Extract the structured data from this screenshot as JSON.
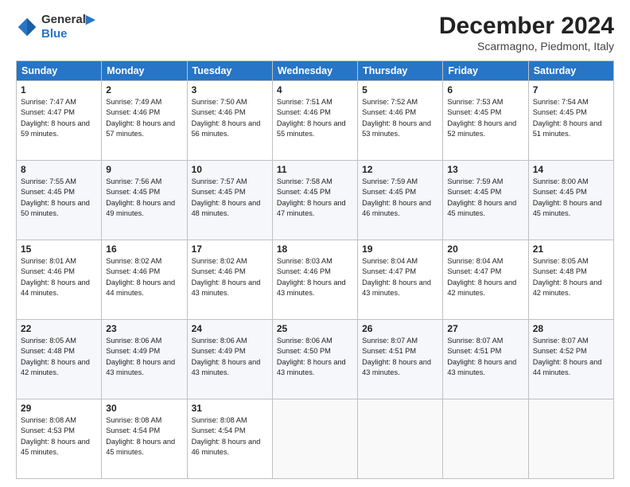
{
  "header": {
    "logo_line1": "General",
    "logo_line2": "Blue",
    "month_title": "December 2024",
    "location": "Scarmagno, Piedmont, Italy"
  },
  "weekdays": [
    "Sunday",
    "Monday",
    "Tuesday",
    "Wednesday",
    "Thursday",
    "Friday",
    "Saturday"
  ],
  "weeks": [
    [
      {
        "day": "1",
        "sunrise": "Sunrise: 7:47 AM",
        "sunset": "Sunset: 4:47 PM",
        "daylight": "Daylight: 8 hours and 59 minutes."
      },
      {
        "day": "2",
        "sunrise": "Sunrise: 7:49 AM",
        "sunset": "Sunset: 4:46 PM",
        "daylight": "Daylight: 8 hours and 57 minutes."
      },
      {
        "day": "3",
        "sunrise": "Sunrise: 7:50 AM",
        "sunset": "Sunset: 4:46 PM",
        "daylight": "Daylight: 8 hours and 56 minutes."
      },
      {
        "day": "4",
        "sunrise": "Sunrise: 7:51 AM",
        "sunset": "Sunset: 4:46 PM",
        "daylight": "Daylight: 8 hours and 55 minutes."
      },
      {
        "day": "5",
        "sunrise": "Sunrise: 7:52 AM",
        "sunset": "Sunset: 4:46 PM",
        "daylight": "Daylight: 8 hours and 53 minutes."
      },
      {
        "day": "6",
        "sunrise": "Sunrise: 7:53 AM",
        "sunset": "Sunset: 4:45 PM",
        "daylight": "Daylight: 8 hours and 52 minutes."
      },
      {
        "day": "7",
        "sunrise": "Sunrise: 7:54 AM",
        "sunset": "Sunset: 4:45 PM",
        "daylight": "Daylight: 8 hours and 51 minutes."
      }
    ],
    [
      {
        "day": "8",
        "sunrise": "Sunrise: 7:55 AM",
        "sunset": "Sunset: 4:45 PM",
        "daylight": "Daylight: 8 hours and 50 minutes."
      },
      {
        "day": "9",
        "sunrise": "Sunrise: 7:56 AM",
        "sunset": "Sunset: 4:45 PM",
        "daylight": "Daylight: 8 hours and 49 minutes."
      },
      {
        "day": "10",
        "sunrise": "Sunrise: 7:57 AM",
        "sunset": "Sunset: 4:45 PM",
        "daylight": "Daylight: 8 hours and 48 minutes."
      },
      {
        "day": "11",
        "sunrise": "Sunrise: 7:58 AM",
        "sunset": "Sunset: 4:45 PM",
        "daylight": "Daylight: 8 hours and 47 minutes."
      },
      {
        "day": "12",
        "sunrise": "Sunrise: 7:59 AM",
        "sunset": "Sunset: 4:45 PM",
        "daylight": "Daylight: 8 hours and 46 minutes."
      },
      {
        "day": "13",
        "sunrise": "Sunrise: 7:59 AM",
        "sunset": "Sunset: 4:45 PM",
        "daylight": "Daylight: 8 hours and 45 minutes."
      },
      {
        "day": "14",
        "sunrise": "Sunrise: 8:00 AM",
        "sunset": "Sunset: 4:45 PM",
        "daylight": "Daylight: 8 hours and 45 minutes."
      }
    ],
    [
      {
        "day": "15",
        "sunrise": "Sunrise: 8:01 AM",
        "sunset": "Sunset: 4:46 PM",
        "daylight": "Daylight: 8 hours and 44 minutes."
      },
      {
        "day": "16",
        "sunrise": "Sunrise: 8:02 AM",
        "sunset": "Sunset: 4:46 PM",
        "daylight": "Daylight: 8 hours and 44 minutes."
      },
      {
        "day": "17",
        "sunrise": "Sunrise: 8:02 AM",
        "sunset": "Sunset: 4:46 PM",
        "daylight": "Daylight: 8 hours and 43 minutes."
      },
      {
        "day": "18",
        "sunrise": "Sunrise: 8:03 AM",
        "sunset": "Sunset: 4:46 PM",
        "daylight": "Daylight: 8 hours and 43 minutes."
      },
      {
        "day": "19",
        "sunrise": "Sunrise: 8:04 AM",
        "sunset": "Sunset: 4:47 PM",
        "daylight": "Daylight: 8 hours and 43 minutes."
      },
      {
        "day": "20",
        "sunrise": "Sunrise: 8:04 AM",
        "sunset": "Sunset: 4:47 PM",
        "daylight": "Daylight: 8 hours and 42 minutes."
      },
      {
        "day": "21",
        "sunrise": "Sunrise: 8:05 AM",
        "sunset": "Sunset: 4:48 PM",
        "daylight": "Daylight: 8 hours and 42 minutes."
      }
    ],
    [
      {
        "day": "22",
        "sunrise": "Sunrise: 8:05 AM",
        "sunset": "Sunset: 4:48 PM",
        "daylight": "Daylight: 8 hours and 42 minutes."
      },
      {
        "day": "23",
        "sunrise": "Sunrise: 8:06 AM",
        "sunset": "Sunset: 4:49 PM",
        "daylight": "Daylight: 8 hours and 43 minutes."
      },
      {
        "day": "24",
        "sunrise": "Sunrise: 8:06 AM",
        "sunset": "Sunset: 4:49 PM",
        "daylight": "Daylight: 8 hours and 43 minutes."
      },
      {
        "day": "25",
        "sunrise": "Sunrise: 8:06 AM",
        "sunset": "Sunset: 4:50 PM",
        "daylight": "Daylight: 8 hours and 43 minutes."
      },
      {
        "day": "26",
        "sunrise": "Sunrise: 8:07 AM",
        "sunset": "Sunset: 4:51 PM",
        "daylight": "Daylight: 8 hours and 43 minutes."
      },
      {
        "day": "27",
        "sunrise": "Sunrise: 8:07 AM",
        "sunset": "Sunset: 4:51 PM",
        "daylight": "Daylight: 8 hours and 43 minutes."
      },
      {
        "day": "28",
        "sunrise": "Sunrise: 8:07 AM",
        "sunset": "Sunset: 4:52 PM",
        "daylight": "Daylight: 8 hours and 44 minutes."
      }
    ],
    [
      {
        "day": "29",
        "sunrise": "Sunrise: 8:08 AM",
        "sunset": "Sunset: 4:53 PM",
        "daylight": "Daylight: 8 hours and 45 minutes."
      },
      {
        "day": "30",
        "sunrise": "Sunrise: 8:08 AM",
        "sunset": "Sunset: 4:54 PM",
        "daylight": "Daylight: 8 hours and 45 minutes."
      },
      {
        "day": "31",
        "sunrise": "Sunrise: 8:08 AM",
        "sunset": "Sunset: 4:54 PM",
        "daylight": "Daylight: 8 hours and 46 minutes."
      },
      null,
      null,
      null,
      null
    ]
  ]
}
